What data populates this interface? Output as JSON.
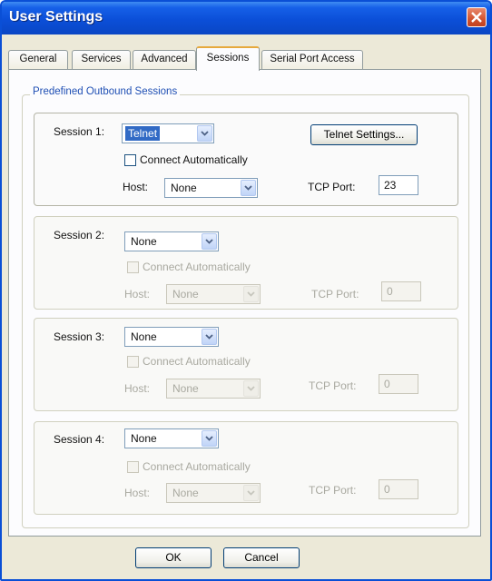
{
  "window": {
    "title": "User Settings"
  },
  "tabs": [
    "General",
    "Services",
    "Advanced",
    "Sessions",
    "Serial Port Access"
  ],
  "group_title": "Predefined Outbound Sessions",
  "sessions": [
    {
      "label": "Session 1:",
      "type": "Telnet",
      "connect_label": "Connect Automatically",
      "connect_checked": false,
      "host_label": "Host:",
      "host_value": "None",
      "port_label": "TCP Port:",
      "port_value": "23",
      "settings_button": "Telnet Settings...",
      "enabled": true
    },
    {
      "label": "Session 2:",
      "type": "None",
      "connect_label": "Connect Automatically",
      "connect_checked": false,
      "host_label": "Host:",
      "host_value": "None",
      "port_label": "TCP Port:",
      "port_value": "0",
      "enabled": false
    },
    {
      "label": "Session 3:",
      "type": "None",
      "connect_label": "Connect Automatically",
      "connect_checked": false,
      "host_label": "Host:",
      "host_value": "None",
      "port_label": "TCP Port:",
      "port_value": "0",
      "enabled": false
    },
    {
      "label": "Session 4:",
      "type": "None",
      "connect_label": "Connect Automatically",
      "connect_checked": false,
      "host_label": "Host:",
      "host_value": "None",
      "port_label": "TCP Port:",
      "port_value": "0",
      "enabled": false
    }
  ],
  "buttons": {
    "ok": "OK",
    "cancel": "Cancel"
  },
  "colors": {
    "title_bar": "#0a4fd6",
    "active_tab_accent": "#e6a93d",
    "group_title": "#1f4fb4",
    "selection": "#316ac5"
  }
}
